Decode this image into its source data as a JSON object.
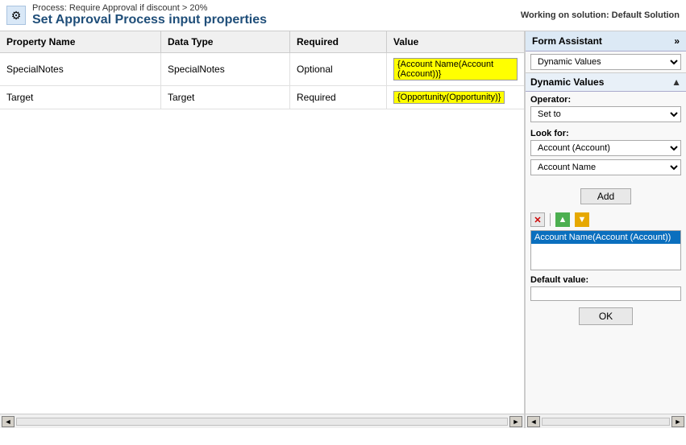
{
  "topBar": {
    "processLabel": "Process: Require Approval if discount > 20%",
    "pageTitle": "Set Approval Process input properties",
    "workingOn": "Working on solution: Default Solution",
    "gearIcon": "⚙"
  },
  "table": {
    "headers": [
      "Property Name",
      "Data Type",
      "Required",
      "Value"
    ],
    "rows": [
      {
        "propertyName": "SpecialNotes",
        "dataType": "SpecialNotes",
        "required": "Optional",
        "value": "{Account Name(Account (Account))}"
      },
      {
        "propertyName": "Target",
        "dataType": "Target",
        "required": "Required",
        "value": "{Opportunity(Opportunity)}"
      }
    ]
  },
  "formAssistant": {
    "title": "Form Assistant",
    "chevron": "»",
    "dynamicValuesLabel": "Dynamic Values",
    "collapseArrow": "▲",
    "dvSectionLabel": "Dynamic Values",
    "operatorLabel": "Operator:",
    "operatorValue": "Set to",
    "lookForLabel": "Look for:",
    "lookForValue": "Account (Account)",
    "fieldValue": "Account Name",
    "addButton": "Add",
    "selectedItem": "Account Name(Account (Account))",
    "defaultValueLabel": "Default value:",
    "defaultValuePlaceholder": "",
    "okButton": "OK"
  },
  "scrollbar": {
    "leftArrow": "◄",
    "rightArrow": "►"
  }
}
